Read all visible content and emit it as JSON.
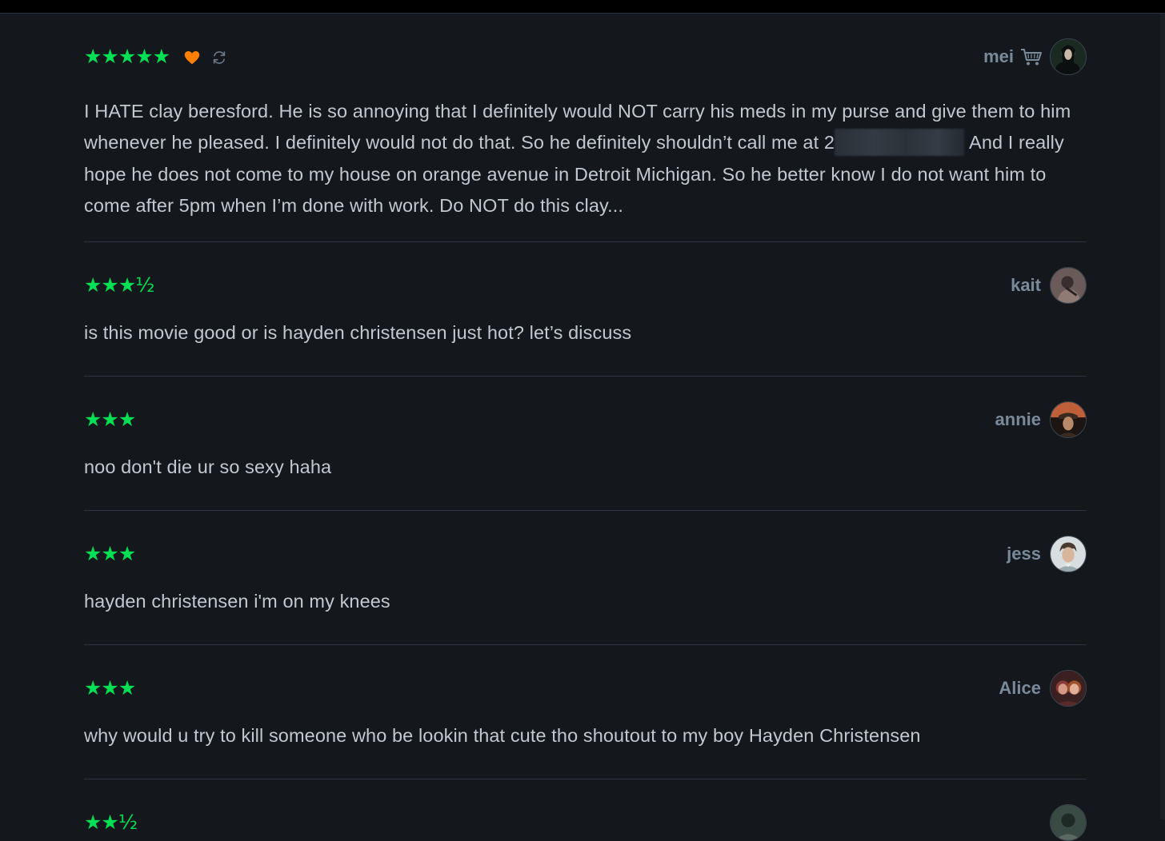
{
  "reviews": [
    {
      "rating": "★★★★★",
      "liked": true,
      "rewatch": true,
      "username": "mei",
      "patron": true,
      "avatar_colors": [
        "#1a2a22",
        "#3f6f5a",
        "#0b0f10"
      ],
      "text_before_blur": "I HATE clay beresford. He is so annoying that I definitely would NOT carry his meds in my purse and give them to him whenever he pleased. I definitely would not do that. So he definitely shouldn’t call me at 2",
      "text_after_blur": "And I really hope he does not come to my house on orange avenue in Detroit Michigan. So he better know I do not want him to come after 5pm when I’m done with work. Do NOT do this clay..."
    },
    {
      "rating": "★★★½",
      "username": "kait",
      "avatar_colors": [
        "#6a5a58",
        "#3a2d2e",
        "#8f7a74"
      ],
      "text": "is this movie good or is hayden christensen just hot? let’s discuss"
    },
    {
      "rating": "★★★",
      "username": "annie",
      "avatar_colors": [
        "#c0603a",
        "#3a2a20",
        "#1c1511"
      ],
      "text": "noo don't die ur so sexy haha"
    },
    {
      "rating": "★★★",
      "username": "jess",
      "avatar_colors": [
        "#d8dde0",
        "#4a3a32",
        "#9aa8b0"
      ],
      "text": "hayden christensen i'm on my knees"
    },
    {
      "rating": "★★★",
      "username": "Alice",
      "avatar_colors": [
        "#8a3a3a",
        "#d49a86",
        "#3a2020"
      ],
      "text": "why would u try to kill someone who be lookin that cute tho shoutout to my boy Hayden Christensen"
    },
    {
      "rating": "★★½",
      "username": "",
      "avatar_colors": [
        "#3a4a44",
        "#1e2a26",
        "#5a6a62"
      ],
      "text": ""
    }
  ],
  "colors": {
    "background": "#14181c",
    "star": "#00e054",
    "like": "#ff8000",
    "username": "#7a8a9b",
    "text": "#c1c8cf",
    "divider": "#2c3440"
  },
  "icons": {
    "like": "heart-icon",
    "rewatch": "rewatch-icon",
    "patron": "cart-icon"
  }
}
